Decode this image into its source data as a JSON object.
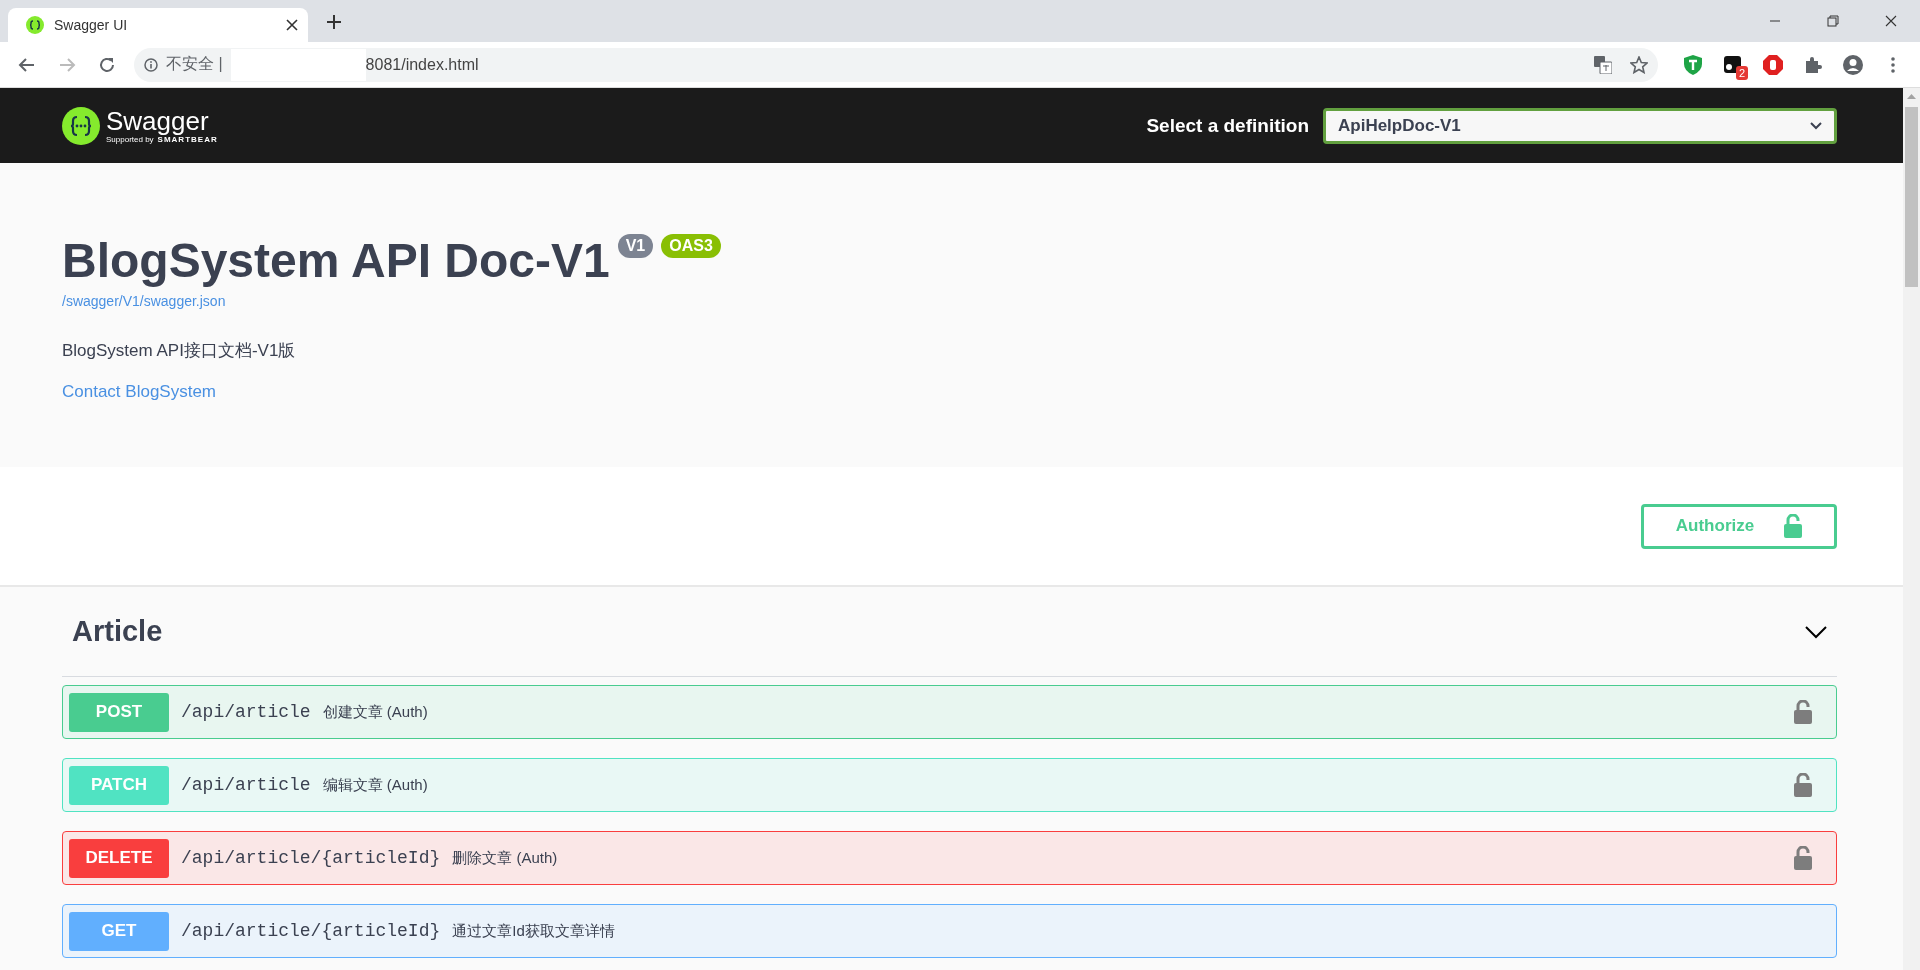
{
  "browser": {
    "tab_title": "Swagger UI",
    "url_security": "不安全 |",
    "url": "8081/index.html",
    "extension_badge": "2"
  },
  "topbar": {
    "logo_text": "Swagger",
    "logo_sub": "Supported by",
    "logo_brand": "SMARTBEAR",
    "definition_label": "Select a definition",
    "definition_value": "ApiHelpDoc-V1"
  },
  "info": {
    "title": "BlogSystem API Doc-V1",
    "version": "V1",
    "spec_version": "OAS3",
    "spec_link": "/swagger/V1/swagger.json",
    "description": "BlogSystem API接口文档-V1版",
    "contact": "Contact BlogSystem"
  },
  "authorize_button": "Authorize",
  "tags": [
    {
      "name": "Article",
      "expanded": true,
      "operations": [
        {
          "method": "POST",
          "kind": "post",
          "path": "/api/article",
          "summary": "创建文章 (Auth)",
          "locked": true
        },
        {
          "method": "PATCH",
          "kind": "patch",
          "path": "/api/article",
          "summary": "编辑文章 (Auth)",
          "locked": true
        },
        {
          "method": "DELETE",
          "kind": "delete",
          "path": "/api/article/{articleId}",
          "summary": "删除文章 (Auth)",
          "locked": true
        },
        {
          "method": "GET",
          "kind": "get",
          "path": "/api/article/{articleId}",
          "summary": "通过文章Id获取文章详情",
          "locked": false
        }
      ]
    }
  ]
}
